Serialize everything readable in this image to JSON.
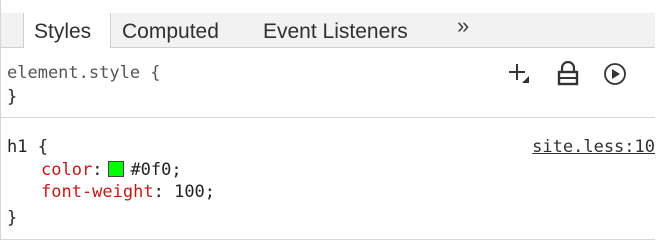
{
  "tabs": [
    {
      "label": "Styles"
    },
    {
      "label": "Computed"
    },
    {
      "label": "Event Listeners"
    }
  ],
  "more_tabs_label": "»",
  "element_style": {
    "selector": "element.style {",
    "close": "}",
    "icons": [
      "new-style-rule-icon",
      "toggle-element-state-icon",
      "animations-icon"
    ]
  },
  "rule": {
    "selector": "h1 {",
    "source": "site.less:10",
    "properties": [
      {
        "name": "color",
        "value": "#0f0;",
        "swatch": "#00ff00"
      },
      {
        "name": "font-weight",
        "value": "100;"
      }
    ],
    "close": "}"
  }
}
